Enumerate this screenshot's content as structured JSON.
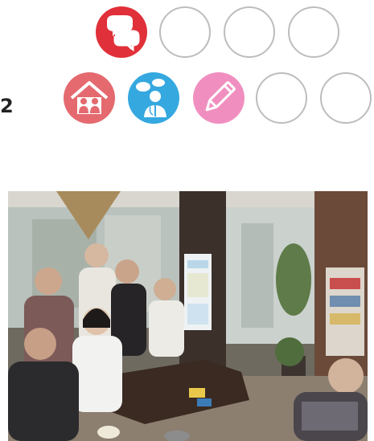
{
  "row_number": "2",
  "icons": {
    "row1": [
      "chat-bubbles-icon",
      "empty",
      "empty",
      "empty"
    ],
    "row2": [
      "house-people-icon",
      "doctor-consult-icon",
      "pencil-icon",
      "empty",
      "empty"
    ]
  },
  "colors": {
    "chat": "#e03039",
    "house": "#e46a6f",
    "doctor": "#35a8e0",
    "pencil": "#f08fbf",
    "empty_border": "#bdbdbd"
  },
  "photo": {
    "description_icon": "group-photo",
    "poster_text": "..."
  }
}
